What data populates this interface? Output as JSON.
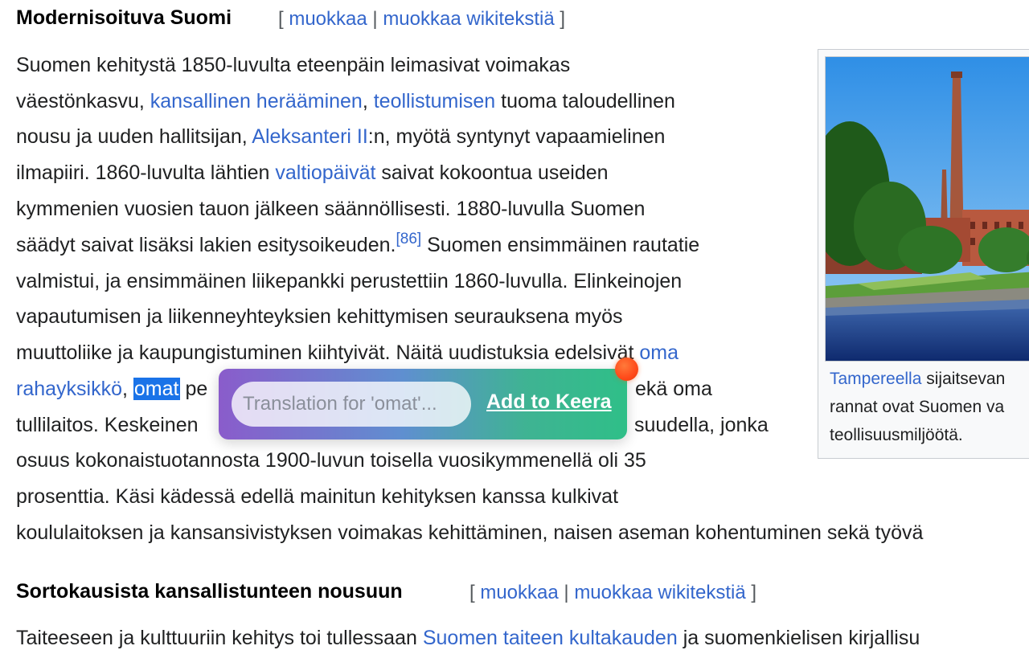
{
  "section1": {
    "heading": "Modernisoituva Suomi",
    "edit_open": "[",
    "edit_link": "muokkaa",
    "edit_sep": "|",
    "edit_wiki_link": "muokkaa wikitekstiä",
    "edit_close": "]"
  },
  "paragraph": {
    "l1": "Suomen kehitystä 1850-luvulta eteenpäin leimasivat voimakas",
    "l2a": "väestönkasvu, ",
    "l2_link1": "kansallinen herääminen",
    "l2b": ", ",
    "l2_link2": "teollistumisen",
    "l2c": " tuoma taloudellinen",
    "l3a": "nousu ja uuden hallitsijan, ",
    "l3_link": "Aleksanteri II",
    "l3b": ":n, myötä syntynyt vapaamielinen",
    "l4a": "ilmapiiri. 1860-luvulta lähtien ",
    "l4_link": "valtiopäivät",
    "l4b": " saivat kokoontua useiden",
    "l5": "kymmenien vuosien tauon jälkeen säännöllisesti. 1880-luvulla Suomen",
    "l6a": "säädyt saivat lisäksi lakien esitysoikeuden.",
    "l6_ref": "[86]",
    "l6b": " Suomen ensimmäinen rautatie",
    "l7": "valmistui, ja ensimmäinen liikepankki perustettiin 1860-luvulla. Elinkeinojen",
    "l8": "vapautumisen ja liikenneyhteyksien kehittymisen seurauksena myös",
    "l9a": "muuttoliike ja kaupungistuminen kiihtyivät. Näitä uudistuksia edelsivät ",
    "l9_link": "oma",
    "l10_link": "rahayksikkö",
    "l10a": ", ",
    "l10_selected": "omat",
    "l10b": " pe",
    "l10c": "ekä oma",
    "l11a": "tullilaitos. Keskeinen",
    "l11b": "suudella, jonka",
    "l12": "osuus kokonaistuotannosta 1900-luvun toisella vuosikymmenellä oli 35",
    "l13": "prosenttia. Käsi kädessä edellä mainitun kehityksen kanssa kulkivat",
    "l14": "koululaitoksen ja kansansivistyksen voimakas kehittäminen, naisen aseman kohentuminen sekä työvä"
  },
  "thumb": {
    "caption_link": "Tampereella",
    "caption_l1": " sijaitsevan",
    "caption_l2": "rannat ovat Suomen va",
    "caption_l3": "teollisuusmiljöötä."
  },
  "popup": {
    "placeholder": "Translation for 'omat'...",
    "add_label": "Add to Keera"
  },
  "section2": {
    "heading": "Sortokausista kansallistunteen nousuun",
    "edit_open": "[",
    "edit_link": "muokkaa",
    "edit_sep": "|",
    "edit_wiki_link": "muokkaa wikitekstiä",
    "edit_close": "]",
    "text_a": "Taiteeseen ja kulttuuriin kehitys toi tullessaan ",
    "text_link": "Suomen taiteen kultakauden",
    "text_b": " ja suomenkielisen kirjallisu"
  }
}
